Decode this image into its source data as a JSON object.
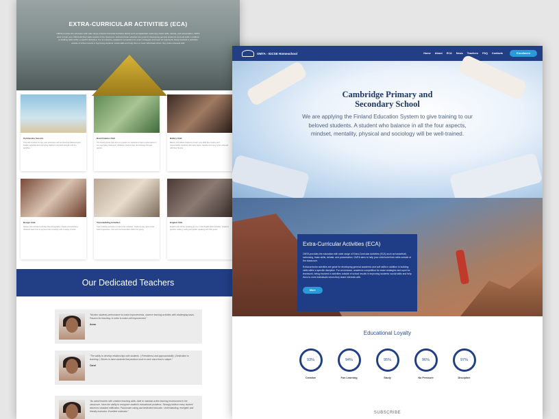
{
  "left": {
    "hero": {
      "title": "EXTRA-CURRICULAR ACTIVITIES (ECA)",
      "text": "OMTA provides the education with wide range of Extra-Curricular Activities (ECA) such as basketball, swimming, basic skills, debate, and presentation. OMTA aims to help your child build their skills outside of the classroom. Extracurricular activities are great for developing general academic and soft skills in addition to building skills within a specific discipline. For an instance, academic competition for exam strategies and sport for teamwork, being involved in activities outside of school results in improving students' social skills and help them to meet individuals whom they share interests with."
    },
    "cards": [
      {
        "title": "Gymnastics Session",
        "text": "This club consists for two main purposes such as fostering balanced and healthy activities and improving children's physical strength with fun activities.",
        "img": "#7fb8d8"
      },
      {
        "title": "Board Games Club",
        "text": "The board games club aims to prepare our students to have a great game in our secondary classroom. Students practice logic and strategy through games.",
        "img": "#6a8f5a"
      },
      {
        "title": "Bakery Club",
        "text": "Bakery club allows students to learn new skills like cooking and responsibility. Students will make cakes, cookies and many types of bread with their friends.",
        "img": "#7a5a48"
      },
      {
        "title": "Design Club",
        "text": "Design club includes activities like photography, drawing and painting. Students learn how to express their creativity with a variety of tools.",
        "img": "#8a5a48"
      },
      {
        "title": "Team Building Activities",
        "text": "Team building activities consist of fun activities. Students play games that build cooperation, trust and communication within the group.",
        "img": "#9c8a78"
      },
      {
        "title": "English Club",
        "text": "English club will be speaking as one of the English ESA activities. Students practice reading, writing and public speaking with their peers.",
        "img": "#5a4a42"
      }
    ],
    "teachers_title": "Our Dedicated Teachers",
    "teachers": [
      {
        "quote": "\"Monitor students performance to make improvements, observe learning activities with challenging tasks. Passion for teaching: in order to make self improvement.\"",
        "name": "Anna"
      },
      {
        "quote": "\"The ability to develop relationships with students. | Friendliness and approachability | Dedication to teaching. | Strives to have students that produce work in each class that is unique.\"",
        "name": "Carol"
      },
      {
        "quote": "\"An adroit teacher with creative teaching skills. Able to maintain active learning environment in the classroom. Have the ability to recognize student's educational problems. Strongly believe every student deserves standard edification. Passionate caring and dedicated educator. Understanding, energetic and friendly instructor. Excellent motivator.\"",
        "name": ""
      }
    ]
  },
  "right": {
    "nav": {
      "brand": "OMTA - IGCSE Homeschool",
      "items": [
        "Home",
        "About",
        "ECA",
        "News",
        "Teachers",
        "FAQ",
        "Contacts"
      ],
      "cta": "Enrollment"
    },
    "hero": {
      "title_line1": "Cambridge Primary and",
      "title_line2": "Secondary School",
      "text": "We are applying the Finland Education System to give training to our beloved students. A student who balance in all the four aspects, mindset, mentality, physical and sociology will be well-trained."
    },
    "eca": {
      "title": "Extra-Curricular Activities (ECA)",
      "p1": "OMTA provides the education with wide range of Extra-Curricular Activities (ECA) such as basketball, swimming, basic skills, debate, and presentation. OMTA aims to help your child build their skills outside of the classroom.",
      "p2": "Extracurricular activities are great for developing general academic and soft skills in addition to building skills within a specific discipline. For an instance, academic competition for exam strategies and sport for teamwork, being involved in activities outside of school results in improving students' social skills and help them to meet individuals whom they share interests with.",
      "button": "More"
    },
    "loyalty": {
      "title": "Educational Loyalty",
      "items": [
        {
          "value": "93%",
          "label": "Creative"
        },
        {
          "value": "94%",
          "label": "Fun Learning"
        },
        {
          "value": "95%",
          "label": "Study"
        },
        {
          "value": "96%",
          "label": "No Pressure"
        },
        {
          "value": "97%",
          "label": "Discipline"
        }
      ]
    },
    "subscribe": "SUBSCRIBE"
  }
}
